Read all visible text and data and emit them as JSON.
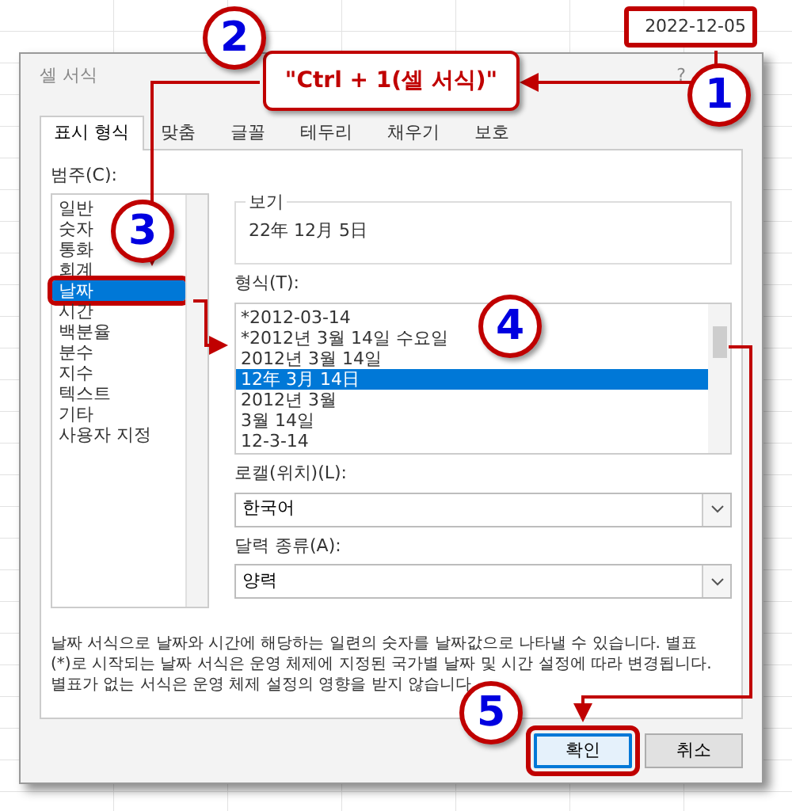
{
  "spreadsheet": {
    "cell_value": "2022-12-05"
  },
  "dialog": {
    "title": "셀 서식",
    "help": "?",
    "tabs": [
      {
        "label": "표시 형식",
        "selected": true
      },
      {
        "label": "맞춤",
        "selected": false
      },
      {
        "label": "글꼴",
        "selected": false
      },
      {
        "label": "테두리",
        "selected": false
      },
      {
        "label": "채우기",
        "selected": false
      },
      {
        "label": "보호",
        "selected": false
      }
    ],
    "category_label": "범주(C):",
    "categories": [
      {
        "label": "일반",
        "selected": false
      },
      {
        "label": "숫자",
        "selected": false
      },
      {
        "label": "통화",
        "selected": false
      },
      {
        "label": "회계",
        "selected": false
      },
      {
        "label": "날짜",
        "selected": true
      },
      {
        "label": "시간",
        "selected": false
      },
      {
        "label": "백분율",
        "selected": false
      },
      {
        "label": "분수",
        "selected": false
      },
      {
        "label": "지수",
        "selected": false
      },
      {
        "label": "텍스트",
        "selected": false
      },
      {
        "label": "기타",
        "selected": false
      },
      {
        "label": "사용자 지정",
        "selected": false
      }
    ],
    "preview": {
      "label": "보기",
      "value": "22年 12月 5日"
    },
    "format_label": "형식(T):",
    "formats": [
      {
        "label": "*2012-03-14",
        "selected": false
      },
      {
        "label": "*2012년 3월 14일 수요일",
        "selected": false
      },
      {
        "label": "2012년 3월 14일",
        "selected": false
      },
      {
        "label": "12年 3月 14日",
        "selected": true
      },
      {
        "label": "2012년 3월",
        "selected": false
      },
      {
        "label": "3월 14일",
        "selected": false
      },
      {
        "label": "12-3-14",
        "selected": false
      }
    ],
    "locale": {
      "label": "로캘(위치)(L):",
      "value": "한국어"
    },
    "calendar": {
      "label": "달력 종류(A):",
      "value": "양력"
    },
    "description": "날짜 서식으로 날짜와 시간에 해당하는 일련의 숫자를 날짜값으로 나타낼 수 있습니다. 별표(*)로 시작되는 날짜 서식은 운영 체제에 지정된 국가별 날짜 및 시간 설정에 따라 변경됩니다. 별표가 없는 서식은 운영 체제 설정의 영향을 받지 않습니다.",
    "buttons": [
      {
        "label": "확인",
        "default": true
      },
      {
        "label": "취소",
        "default": false
      }
    ]
  },
  "annotations": {
    "callout": "\"Ctrl + 1(셀 서식)\"",
    "steps": [
      "1",
      "2",
      "3",
      "4",
      "5"
    ]
  }
}
